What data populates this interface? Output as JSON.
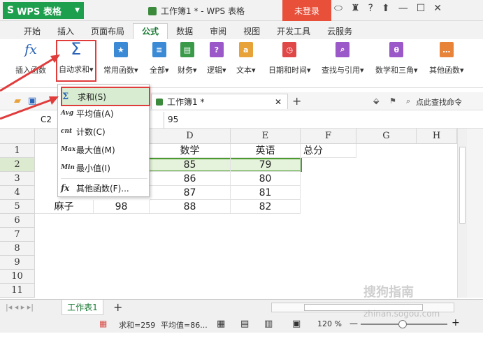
{
  "app": {
    "name": "WPS 表格",
    "doc_title": "工作簿1 * - WPS 表格",
    "login": "未登录",
    "help": "?"
  },
  "menu_tabs": [
    "开始",
    "插入",
    "页面布局",
    "公式",
    "数据",
    "审阅",
    "视图",
    "开发工具",
    "云服务"
  ],
  "ribbon": {
    "insert_func": "插入函数",
    "autosum": "自动求和",
    "common": "常用函数",
    "all": "全部",
    "finance": "财务",
    "logic": "逻辑",
    "text": "文本",
    "datetime": "日期和时间",
    "lookup": "查找与引用",
    "math": "数学和三角",
    "other": "其他函数"
  },
  "doc_tab": "工作簿1 *",
  "find_cmd": "点此查找命令",
  "cell_ref": "C2",
  "formula_value": "95",
  "columns": [
    "D",
    "E",
    "F",
    "G",
    "H"
  ],
  "row_numbers": [
    "1",
    "2",
    "3",
    "4",
    "5",
    "6",
    "7",
    "8",
    "9",
    "10",
    "11"
  ],
  "cells": {
    "d1": "数学",
    "e1": "英语",
    "f1": "总分",
    "d2": "85",
    "e2": "79",
    "d3": "86",
    "e3": "80",
    "d4": "87",
    "e4": "81",
    "a5": "麻子",
    "c5": "98",
    "d5": "88",
    "e5": "82"
  },
  "dropdown": [
    {
      "icon": "Σ",
      "label": "求和(S)"
    },
    {
      "icon": "Avg",
      "label": "平均值(A)"
    },
    {
      "icon": "cnt",
      "label": "计数(C)"
    },
    {
      "icon": "Max",
      "label": "最大值(M)"
    },
    {
      "icon": "Min",
      "label": "最小值(I)"
    },
    {
      "icon": "fx",
      "label": "其他函数(F)..."
    }
  ],
  "sheet_tab": "工作表1",
  "status": {
    "sum": "求和=259",
    "avg": "平均值=86...",
    "zoom": "120 %"
  },
  "watermark": "搜狗指南",
  "watermark_url": "zhinan.sogou.com",
  "colors": {
    "accent_green": "#1e9f4e",
    "login_red": "#e8503a",
    "highlight_red": "#e03c3c",
    "selection_fill": "#e6f3dc"
  }
}
